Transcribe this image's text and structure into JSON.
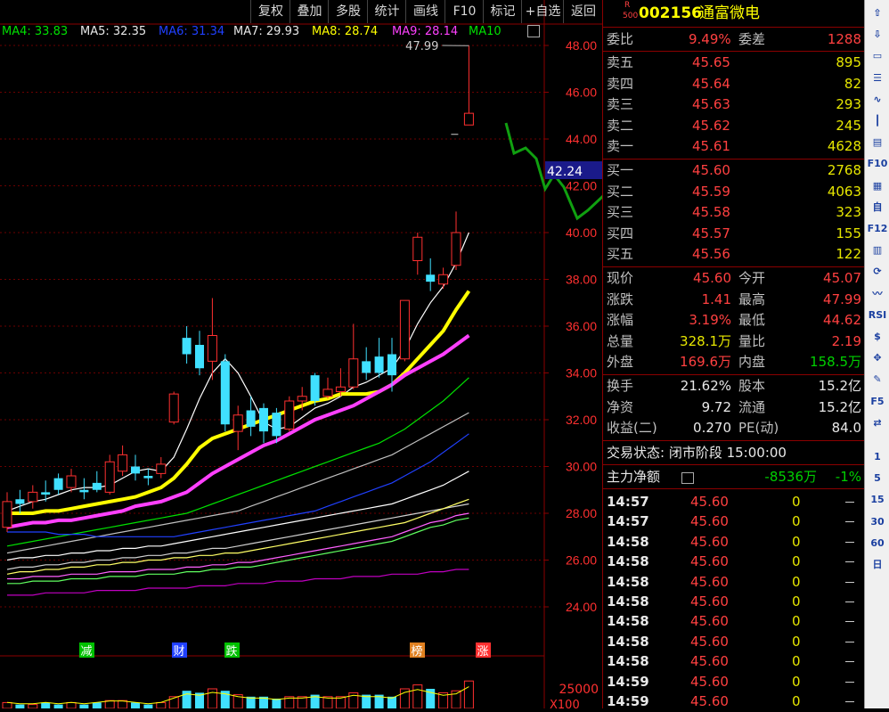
{
  "toolbar": [
    "复权",
    "叠加",
    "多股",
    "统计",
    "画线",
    "F10",
    "标记",
    "+自选",
    "返回"
  ],
  "ma_labels": [
    {
      "text": "MA4: 33.83",
      "color": "#00e000"
    },
    {
      "text": "MA5: 32.35",
      "color": "#e8e8e8"
    },
    {
      "text": "MA6: 31.34",
      "color": "#2040ff"
    },
    {
      "text": "MA7: 29.93",
      "color": "#e8e8e8"
    },
    {
      "text": "MA8: 28.74",
      "color": "#ffff00"
    },
    {
      "text": "MA9: 28.14",
      "color": "#ff40ff"
    },
    {
      "text": "MA10",
      "color": "#00e000"
    }
  ],
  "chart_data": {
    "type": "candlestick",
    "ylim": [
      23,
      49
    ],
    "y_ticks": [
      "48.00",
      "46.00",
      "44.00",
      "42.00",
      "40.00",
      "38.00",
      "36.00",
      "34.00",
      "32.00",
      "30.00",
      "28.00",
      "26.00",
      "24.00"
    ],
    "y_tick_values": [
      48,
      46,
      44,
      42,
      40,
      38,
      36,
      34,
      32,
      30,
      28,
      26,
      24
    ],
    "high_annotation": "47.99",
    "cursor_price": "42.24",
    "candles": [
      {
        "o": 27.4,
        "c": 28.5,
        "h": 28.9,
        "l": 27.2
      },
      {
        "o": 28.6,
        "c": 28.4,
        "h": 29.0,
        "l": 28.0
      },
      {
        "o": 28.5,
        "c": 28.9,
        "h": 29.2,
        "l": 28.2
      },
      {
        "o": 28.9,
        "c": 28.8,
        "h": 29.4,
        "l": 28.5
      },
      {
        "o": 29.5,
        "c": 29.0,
        "h": 29.7,
        "l": 28.8
      },
      {
        "o": 29.1,
        "c": 29.6,
        "h": 29.9,
        "l": 28.9
      },
      {
        "o": 29.0,
        "c": 28.9,
        "h": 29.5,
        "l": 28.6
      },
      {
        "o": 29.3,
        "c": 29.0,
        "h": 29.8,
        "l": 28.9
      },
      {
        "o": 28.9,
        "c": 30.2,
        "h": 30.5,
        "l": 28.8
      },
      {
        "o": 29.8,
        "c": 30.5,
        "h": 30.9,
        "l": 29.6
      },
      {
        "o": 30.0,
        "c": 29.7,
        "h": 30.5,
        "l": 29.4
      },
      {
        "o": 29.6,
        "c": 29.5,
        "h": 29.9,
        "l": 29.2
      },
      {
        "o": 29.7,
        "c": 30.1,
        "h": 30.4,
        "l": 29.5
      },
      {
        "o": 31.9,
        "c": 33.1,
        "h": 33.2,
        "l": 31.8
      },
      {
        "o": 35.5,
        "c": 34.8,
        "h": 36.0,
        "l": 34.4
      },
      {
        "o": 35.2,
        "c": 34.2,
        "h": 35.8,
        "l": 33.9
      },
      {
        "o": 34.5,
        "c": 35.6,
        "h": 37.2,
        "l": 33.7
      },
      {
        "o": 34.5,
        "c": 31.8,
        "h": 34.8,
        "l": 31.5
      },
      {
        "o": 31.5,
        "c": 32.2,
        "h": 32.6,
        "l": 30.7
      },
      {
        "o": 32.4,
        "c": 31.7,
        "h": 33.0,
        "l": 31.3
      },
      {
        "o": 32.5,
        "c": 31.5,
        "h": 32.7,
        "l": 31.0
      },
      {
        "o": 32.3,
        "c": 31.3,
        "h": 32.5,
        "l": 31.0
      },
      {
        "o": 31.6,
        "c": 32.8,
        "h": 33.0,
        "l": 31.5
      },
      {
        "o": 32.8,
        "c": 33.0,
        "h": 33.4,
        "l": 32.4
      },
      {
        "o": 33.9,
        "c": 32.8,
        "h": 34.0,
        "l": 32.6
      },
      {
        "o": 33.0,
        "c": 33.3,
        "h": 33.8,
        "l": 32.9
      },
      {
        "o": 33.2,
        "c": 33.4,
        "h": 34.2,
        "l": 33.0
      },
      {
        "o": 33.4,
        "c": 34.6,
        "h": 36.1,
        "l": 33.3
      },
      {
        "o": 34.5,
        "c": 34.0,
        "h": 35.1,
        "l": 33.7
      },
      {
        "o": 34.7,
        "c": 34.0,
        "h": 35.5,
        "l": 33.8
      },
      {
        "o": 34.8,
        "c": 33.9,
        "h": 35.5,
        "l": 33.2
      },
      {
        "o": 34.6,
        "c": 37.1,
        "h": 37.1,
        "l": 34.5
      },
      {
        "o": 38.8,
        "c": 39.8,
        "h": 40.0,
        "l": 38.2
      },
      {
        "o": 38.2,
        "c": 37.9,
        "h": 38.9,
        "l": 37.5
      },
      {
        "o": 37.8,
        "c": 38.2,
        "h": 38.5,
        "l": 37.6
      },
      {
        "o": 38.6,
        "c": 40.0,
        "h": 40.9,
        "l": 38.4
      },
      {
        "o": 44.6,
        "c": 45.1,
        "h": 47.99,
        "l": 44.6
      }
    ],
    "ma_lines": [
      {
        "name": "MA4",
        "color": "#ffffff",
        "values": [
          28.1,
          28.3,
          28.5,
          28.6,
          28.8,
          29.0,
          29.1,
          29.1,
          29.2,
          29.5,
          29.8,
          29.9,
          29.8,
          30.4,
          31.6,
          32.9,
          34.0,
          34.6,
          34.0,
          33.0,
          31.9,
          31.6,
          31.7,
          32.1,
          32.5,
          32.7,
          33.0,
          33.4,
          33.6,
          33.9,
          34.2,
          35.0,
          36.1,
          37.0,
          37.7,
          38.7,
          40.0
        ]
      },
      {
        "name": "MA5",
        "color": "#ffff00",
        "values": [
          28.0,
          28.0,
          28.0,
          28.1,
          28.1,
          28.2,
          28.3,
          28.4,
          28.5,
          28.6,
          28.7,
          28.9,
          29.1,
          29.5,
          30.1,
          30.8,
          31.2,
          31.4,
          31.6,
          31.8,
          32.0,
          32.2,
          32.4,
          32.6,
          32.8,
          32.9,
          33.1,
          33.1,
          33.1,
          33.2,
          33.5,
          34.0,
          34.6,
          35.2,
          35.8,
          36.7,
          37.5
        ]
      },
      {
        "name": "MA6",
        "color": "#ff40ff",
        "values": [
          27.4,
          27.5,
          27.6,
          27.6,
          27.7,
          27.7,
          27.8,
          27.9,
          28.0,
          28.1,
          28.3,
          28.4,
          28.5,
          28.7,
          28.9,
          29.3,
          29.7,
          30.0,
          30.3,
          30.6,
          30.9,
          31.1,
          31.4,
          31.7,
          32.0,
          32.2,
          32.4,
          32.6,
          32.9,
          33.2,
          33.5,
          33.9,
          34.2,
          34.5,
          34.8,
          35.2,
          35.6
        ]
      },
      {
        "name": "MA7",
        "color": "#00e000",
        "values": [
          26.6,
          26.7,
          26.8,
          26.9,
          27.0,
          27.1,
          27.2,
          27.3,
          27.4,
          27.5,
          27.6,
          27.7,
          27.8,
          27.9,
          28.0,
          28.2,
          28.4,
          28.6,
          28.8,
          29.0,
          29.2,
          29.4,
          29.6,
          29.8,
          30.0,
          30.2,
          30.4,
          30.6,
          30.8,
          31.0,
          31.3,
          31.6,
          32.0,
          32.4,
          32.8,
          33.3,
          33.8
        ]
      },
      {
        "name": "MA8",
        "color": "#c0c0c0",
        "values": [
          26.3,
          26.4,
          26.5,
          26.6,
          26.7,
          26.8,
          26.9,
          27.0,
          27.1,
          27.2,
          27.3,
          27.4,
          27.5,
          27.6,
          27.7,
          27.8,
          27.9,
          28.0,
          28.1,
          28.3,
          28.5,
          28.7,
          28.9,
          29.1,
          29.3,
          29.5,
          29.7,
          29.9,
          30.1,
          30.3,
          30.5,
          30.8,
          31.1,
          31.4,
          31.7,
          32.0,
          32.3
        ]
      },
      {
        "name": "MA9",
        "color": "#2040ff",
        "values": [
          27.2,
          27.2,
          27.2,
          27.2,
          27.1,
          27.1,
          27.1,
          27.0,
          27.0,
          27.0,
          27.0,
          27.0,
          27.0,
          27.0,
          27.1,
          27.2,
          27.3,
          27.4,
          27.5,
          27.6,
          27.7,
          27.8,
          27.9,
          28.0,
          28.1,
          28.3,
          28.5,
          28.7,
          28.9,
          29.1,
          29.3,
          29.6,
          29.9,
          30.2,
          30.6,
          31.0,
          31.4
        ]
      },
      {
        "name": "MA10",
        "color": "#ffffff",
        "values": [
          26.0,
          26.1,
          26.1,
          26.2,
          26.2,
          26.3,
          26.3,
          26.4,
          26.4,
          26.5,
          26.5,
          26.6,
          26.6,
          26.7,
          26.8,
          26.9,
          27.0,
          27.1,
          27.2,
          27.3,
          27.4,
          27.5,
          27.6,
          27.7,
          27.8,
          27.9,
          28.0,
          28.1,
          28.2,
          28.3,
          28.4,
          28.6,
          28.8,
          29.0,
          29.2,
          29.5,
          29.8
        ]
      },
      {
        "name": "MA11",
        "color": "#d0d0d0",
        "values": [
          25.6,
          25.7,
          25.7,
          25.8,
          25.8,
          25.9,
          25.9,
          26.0,
          26.0,
          26.1,
          26.1,
          26.2,
          26.2,
          26.3,
          26.3,
          26.4,
          26.5,
          26.5,
          26.6,
          26.7,
          26.8,
          26.9,
          27.0,
          27.1,
          27.2,
          27.3,
          27.4,
          27.5,
          27.6,
          27.7,
          27.8,
          27.9,
          28.0,
          28.1,
          28.2,
          28.3,
          28.4
        ]
      },
      {
        "name": "MA12",
        "color": "#ffff66",
        "values": [
          25.4,
          25.5,
          25.5,
          25.6,
          25.6,
          25.7,
          25.7,
          25.8,
          25.8,
          25.9,
          25.9,
          26.0,
          26.0,
          26.1,
          26.1,
          26.2,
          26.2,
          26.3,
          26.3,
          26.4,
          26.5,
          26.6,
          26.7,
          26.8,
          26.9,
          27.0,
          27.1,
          27.2,
          27.3,
          27.4,
          27.5,
          27.6,
          27.8,
          28.0,
          28.2,
          28.4,
          28.6
        ]
      },
      {
        "name": "MA13",
        "color": "#ff60ff",
        "values": [
          25.2,
          25.2,
          25.3,
          25.3,
          25.3,
          25.4,
          25.4,
          25.4,
          25.5,
          25.5,
          25.5,
          25.6,
          25.6,
          25.6,
          25.7,
          25.7,
          25.8,
          25.8,
          25.9,
          25.9,
          26.0,
          26.1,
          26.2,
          26.3,
          26.4,
          26.5,
          26.6,
          26.7,
          26.8,
          26.9,
          27.0,
          27.2,
          27.4,
          27.6,
          27.7,
          27.9,
          28.0
        ]
      },
      {
        "name": "MA14",
        "color": "#60ff60",
        "values": [
          25.0,
          25.0,
          25.1,
          25.1,
          25.1,
          25.2,
          25.2,
          25.2,
          25.3,
          25.3,
          25.3,
          25.4,
          25.4,
          25.4,
          25.5,
          25.5,
          25.6,
          25.6,
          25.7,
          25.7,
          25.8,
          25.9,
          26.0,
          26.1,
          26.2,
          26.3,
          26.4,
          26.5,
          26.6,
          26.7,
          26.8,
          27.0,
          27.2,
          27.4,
          27.5,
          27.7,
          27.8
        ]
      },
      {
        "name": "MA15",
        "color": "#c000c0",
        "values": [
          24.5,
          24.5,
          24.5,
          24.6,
          24.6,
          24.6,
          24.6,
          24.7,
          24.7,
          24.7,
          24.7,
          24.8,
          24.8,
          24.8,
          24.8,
          24.9,
          24.9,
          24.9,
          25.0,
          25.0,
          25.0,
          25.1,
          25.1,
          25.1,
          25.2,
          25.2,
          25.2,
          25.3,
          25.3,
          25.3,
          25.4,
          25.4,
          25.4,
          25.5,
          25.5,
          25.6,
          25.6
        ]
      }
    ],
    "event_tags": [
      {
        "index": 8,
        "text": "减",
        "color": "#00c000"
      },
      {
        "index": 19,
        "text": "财",
        "color": "#2040ff"
      },
      {
        "index": 23,
        "text": "跌",
        "color": "#00c000"
      },
      {
        "index": 46,
        "text": "榜",
        "color": "#e08020"
      },
      {
        "index": 53,
        "text": "涨",
        "color": "#ff3030"
      }
    ],
    "volume_label": "25000",
    "volume_unit": "X100",
    "volumes": [
      3,
      2,
      2,
      3,
      2,
      3,
      2,
      3,
      4,
      4,
      3,
      2,
      3,
      6,
      9,
      8,
      10,
      9,
      7,
      6,
      6,
      5,
      6,
      6,
      7,
      6,
      6,
      8,
      7,
      7,
      6,
      10,
      12,
      10,
      8,
      9,
      14
    ]
  },
  "quote": {
    "code_prefix": "R",
    "code_sub": "500",
    "code": "002156",
    "name": "通富微电",
    "weibi_label": "委比",
    "weibi": "9.49%",
    "weicha_label": "委差",
    "weicha": "1288",
    "asks": [
      {
        "label": "卖五",
        "price": "45.65",
        "vol": "895"
      },
      {
        "label": "卖四",
        "price": "45.64",
        "vol": "82"
      },
      {
        "label": "卖三",
        "price": "45.63",
        "vol": "293"
      },
      {
        "label": "卖二",
        "price": "45.62",
        "vol": "245"
      },
      {
        "label": "卖一",
        "price": "45.61",
        "vol": "4628"
      }
    ],
    "bids": [
      {
        "label": "买一",
        "price": "45.60",
        "vol": "2768"
      },
      {
        "label": "买二",
        "price": "45.59",
        "vol": "4063"
      },
      {
        "label": "买三",
        "price": "45.58",
        "vol": "323"
      },
      {
        "label": "买四",
        "price": "45.57",
        "vol": "155"
      },
      {
        "label": "买五",
        "price": "45.56",
        "vol": "122"
      }
    ],
    "stats": [
      {
        "l1": "现价",
        "v1": "45.60",
        "c1": "red",
        "l2": "今开",
        "v2": "45.07",
        "c2": "red"
      },
      {
        "l1": "涨跌",
        "v1": "1.41",
        "c1": "red",
        "l2": "最高",
        "v2": "47.99",
        "c2": "red"
      },
      {
        "l1": "涨幅",
        "v1": "3.19%",
        "c1": "red",
        "l2": "最低",
        "v2": "44.62",
        "c2": "red"
      },
      {
        "l1": "总量",
        "v1": "328.1万",
        "c1": "yel",
        "l2": "量比",
        "v2": "2.19",
        "c2": "red"
      },
      {
        "l1": "外盘",
        "v1": "169.6万",
        "c1": "red",
        "l2": "内盘",
        "v2": "158.5万",
        "c2": "grn"
      }
    ],
    "fund": [
      {
        "l1": "换手",
        "v1": "21.62%",
        "l2": "股本",
        "v2": "15.2亿"
      },
      {
        "l1": "净资",
        "v1": "9.72",
        "l2": "流通",
        "v2": "15.2亿"
      },
      {
        "l1": "收益(二)",
        "v1": "0.270",
        "l2": "PE(动)",
        "v2": "84.0"
      }
    ],
    "trade_status": "交易状态: 闭市阶段 15:00:00",
    "main_flow_label": "主力净额",
    "main_flow": "-8536万",
    "main_flow_pct": "-1%",
    "ticks": [
      {
        "t": "14:57",
        "p": "45.60",
        "v": "0"
      },
      {
        "t": "14:57",
        "p": "45.60",
        "v": "0"
      },
      {
        "t": "14:58",
        "p": "45.60",
        "v": "0"
      },
      {
        "t": "14:58",
        "p": "45.60",
        "v": "0"
      },
      {
        "t": "14:58",
        "p": "45.60",
        "v": "0"
      },
      {
        "t": "14:58",
        "p": "45.60",
        "v": "0"
      },
      {
        "t": "14:58",
        "p": "45.60",
        "v": "0"
      },
      {
        "t": "14:58",
        "p": "45.60",
        "v": "0"
      },
      {
        "t": "14:58",
        "p": "45.60",
        "v": "0"
      },
      {
        "t": "14:59",
        "p": "45.60",
        "v": "0"
      },
      {
        "t": "14:59",
        "p": "45.60",
        "v": "0"
      }
    ]
  },
  "side_tools": [
    {
      "name": "up-arrow-icon",
      "glyph": "⇧"
    },
    {
      "name": "down-arrow-icon",
      "glyph": "⇩"
    },
    {
      "name": "window-icon",
      "glyph": "▭"
    },
    {
      "name": "list-icon",
      "glyph": "☰"
    },
    {
      "name": "line-chart-icon",
      "glyph": "∿"
    },
    {
      "name": "candle-chart-icon",
      "glyph": "┃"
    },
    {
      "name": "grid-icon",
      "glyph": "▤"
    },
    {
      "name": "f10-button",
      "glyph": "F10"
    },
    {
      "name": "chart-small-icon",
      "glyph": "▦"
    },
    {
      "name": "zixuan-button",
      "glyph": "自"
    },
    {
      "name": "f12-button",
      "glyph": "F12"
    },
    {
      "name": "bar-icon",
      "glyph": "▥"
    },
    {
      "name": "refresh-icon",
      "glyph": "⟳"
    },
    {
      "name": "wave-icon",
      "glyph": "〰"
    },
    {
      "name": "rsi-button",
      "glyph": "RSI"
    },
    {
      "name": "s-button",
      "glyph": "$"
    },
    {
      "name": "move-icon",
      "glyph": "✥"
    },
    {
      "name": "pencil-icon",
      "glyph": "✎"
    },
    {
      "name": "f5-button",
      "glyph": "F5"
    },
    {
      "name": "transfer-icon",
      "glyph": "⇄"
    },
    {
      "name": "period-1-button",
      "glyph": "1"
    },
    {
      "name": "period-5-button",
      "glyph": "5"
    },
    {
      "name": "period-15-button",
      "glyph": "15"
    },
    {
      "name": "period-30-button",
      "glyph": "30"
    },
    {
      "name": "period-60-button",
      "glyph": "60"
    },
    {
      "name": "period-day-button",
      "glyph": "日"
    }
  ]
}
